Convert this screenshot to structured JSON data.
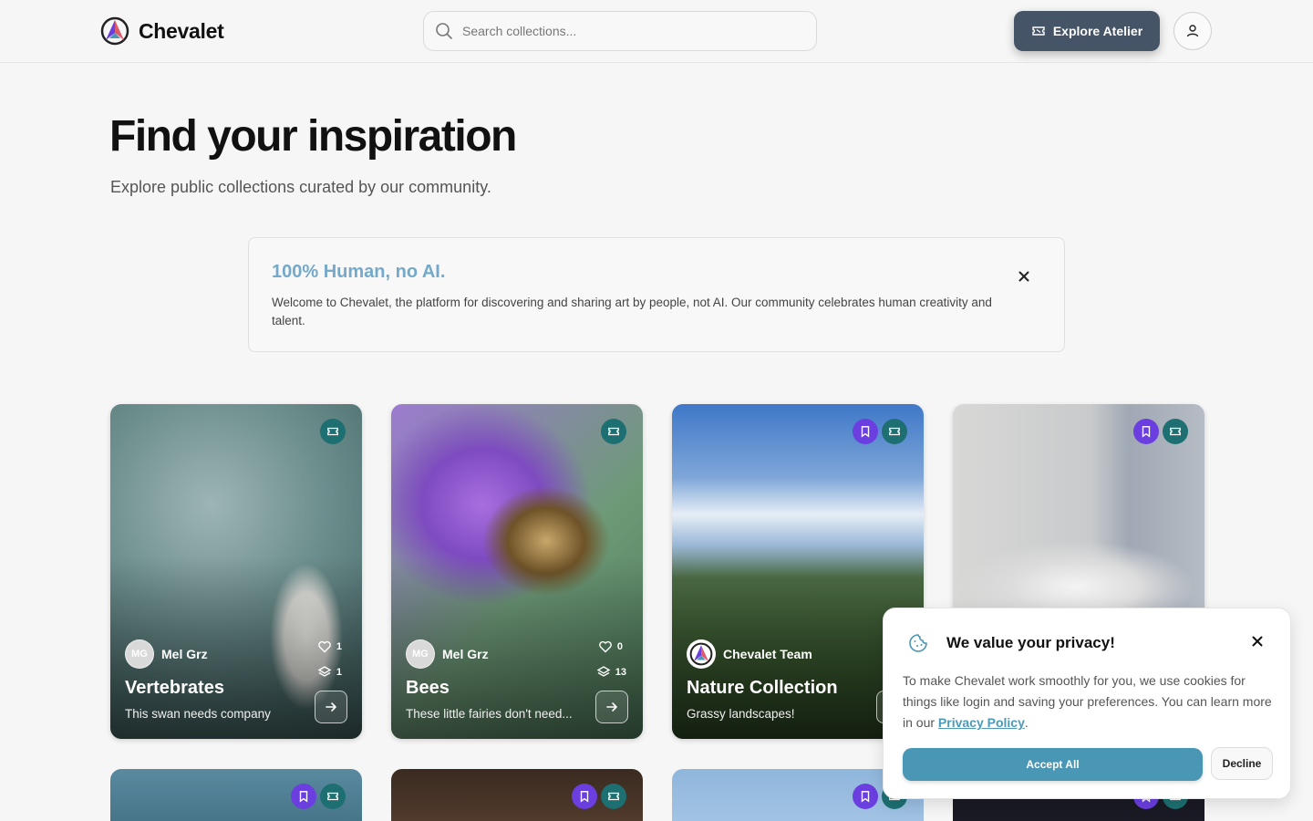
{
  "header": {
    "brand_name": "Chevalet",
    "search_placeholder": "Search collections...",
    "explore_label": "Explore Atelier"
  },
  "hero": {
    "title": "Find your inspiration",
    "subtitle": "Explore public collections curated by our community."
  },
  "notice": {
    "title": "100% Human, no AI.",
    "text": "Welcome to Chevalet, the platform for discovering and sharing art by people, not AI. Our community celebrates human creativity and talent."
  },
  "cards": [
    {
      "owner_initials": "MG",
      "owner": "Mel Grz",
      "title": "Vertebrates",
      "description": "This swan needs company",
      "likes": "1",
      "items": "1"
    },
    {
      "owner_initials": "MG",
      "owner": "Mel Grz",
      "title": "Bees",
      "description": "These little fairies don't need...",
      "likes": "0",
      "items": "13"
    },
    {
      "owner_initials": "",
      "owner": "Chevalet Team",
      "title": "Nature Collection",
      "description": "Grassy landscapes!",
      "likes": "",
      "items": ""
    }
  ],
  "cookie": {
    "title": "We value your privacy!",
    "text_before": "To make Chevalet work smoothly for you, we use cookies for things like login and saving your preferences. You can learn more in our ",
    "link": "Privacy Policy",
    "text_after": ".",
    "accept": "Accept All",
    "decline": "Decline"
  },
  "colors": {
    "explore_button": "#465467",
    "notice_title": "#74a9c9",
    "accept_button": "#4a96b5",
    "badge_teal": "#1d6f72",
    "badge_purple": "#6b3ee0"
  }
}
